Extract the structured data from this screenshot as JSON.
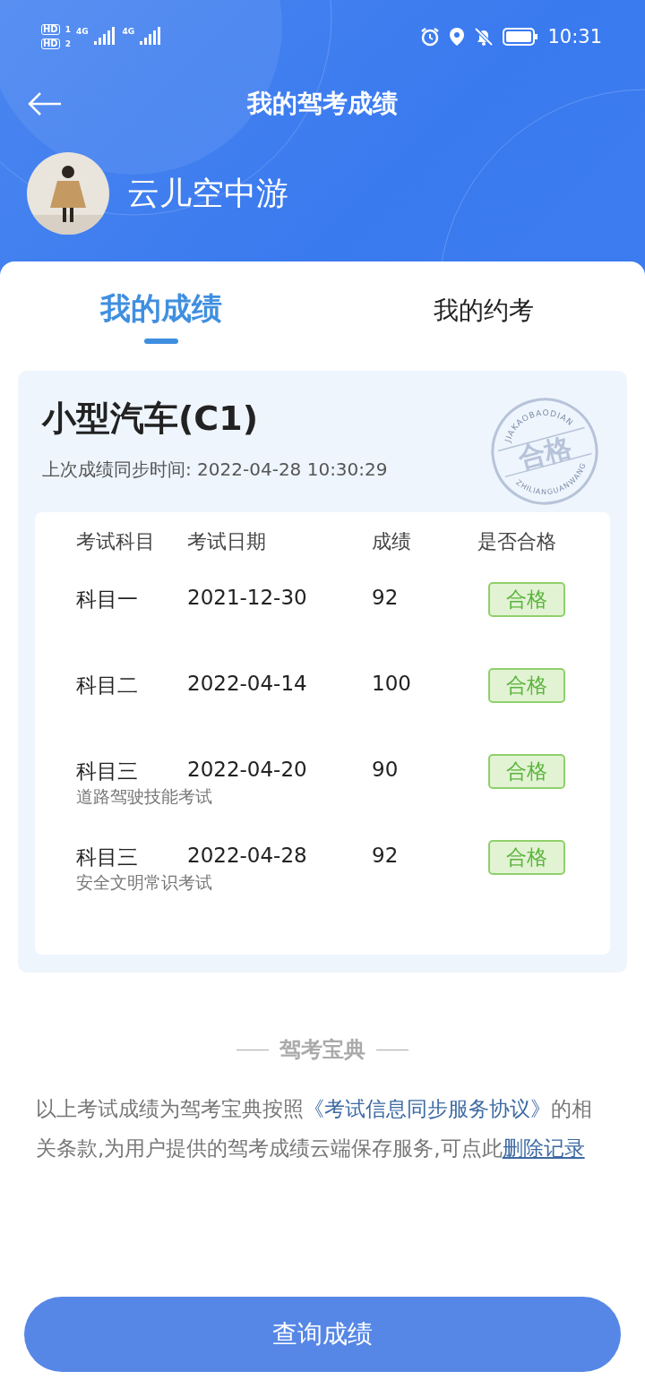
{
  "status_bar": {
    "sims": [
      {
        "hd": "HD",
        "index": "1",
        "network": "4G"
      },
      {
        "hd": "HD",
        "index": "2",
        "network": "4G"
      }
    ],
    "time": "10:31"
  },
  "header": {
    "title": "我的驾考成绩",
    "user_name": "云儿空中游"
  },
  "tabs": [
    {
      "label": "我的成绩",
      "selected": true
    },
    {
      "label": "我的约考",
      "selected": false
    }
  ],
  "license_card": {
    "title": "小型汽车(C1)",
    "sync_time": "上次成绩同步时间: 2022-04-28 10:30:29",
    "stamp": {
      "top": "JIAKAOBAODIAN",
      "center": "合格",
      "bottom": "ZHILIANGUANWANG"
    },
    "table": {
      "columns": [
        "考试科目",
        "考试日期",
        "成绩",
        "是否合格"
      ],
      "rows": [
        {
          "subject": "科目一",
          "date": "2021-12-30",
          "score": "92",
          "result": "合格"
        },
        {
          "subject": "科目二",
          "date": "2022-04-14",
          "score": "100",
          "result": "合格"
        },
        {
          "subject": "科目三",
          "note": "道路驾驶技能考试",
          "date": "2022-04-20",
          "score": "90",
          "result": "合格"
        },
        {
          "subject": "科目三",
          "note": "安全文明常识考试",
          "date": "2022-04-28",
          "score": "92",
          "result": "合格"
        }
      ]
    }
  },
  "footer": {
    "brand": "驾考宝典",
    "text_before": "以上考试成绩为驾考宝典按照",
    "agreement_link": "《考试信息同步服务协议》",
    "text_middle": "的相关条款,为用户提供的驾考成绩云端保存服务,可点此",
    "delete_link": "删除记录"
  },
  "query_button": "查询成绩"
}
